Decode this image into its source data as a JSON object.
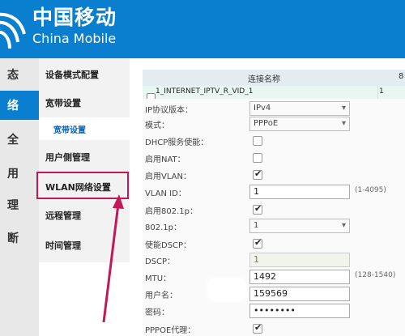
{
  "header": {
    "brand_cn": "中国移动",
    "brand_en": "China Mobile",
    "bg_color": "#0a7fd0"
  },
  "left_nav": [
    {
      "label": "态",
      "active": false
    },
    {
      "label": "络",
      "active": true
    },
    {
      "label": "全",
      "active": false
    },
    {
      "label": "用",
      "active": false
    },
    {
      "label": "理",
      "active": false
    },
    {
      "label": "断",
      "active": false
    }
  ],
  "submenu": {
    "device_mode": "设备模式配置",
    "broadband": "宽带设置",
    "broadband_child": "宽带设置",
    "user_side": "用户侧管理",
    "wlan": "WLAN网络设置",
    "remote": "远程管理",
    "time": "时间管理"
  },
  "grid": {
    "col_name": "连接名称",
    "col_2": "8",
    "row_name": "1_INTERNET_IPTV_R_VID_1",
    "row_val": "1"
  },
  "form": {
    "ip_version_label": "IP协议版本：",
    "ip_version_value": "IPv4",
    "mode_label": "模式：",
    "mode_value": "PPPoE",
    "dhcp_label": "DHCP服务使能：",
    "nat_label": "启用NAT：",
    "vlan_label": "启用VLAN：",
    "vlan_id_label": "VLAN ID：",
    "vlan_id_value": "1",
    "vlan_id_hint": "(1-4095)",
    "p8021_enable_label": "启用802.1p：",
    "p8021_label": "802.1p：",
    "p8021_value": "1",
    "dscp_enable_label": "使能DSCP：",
    "dscp_label": "DSCP：",
    "dscp_value": "1",
    "mtu_label": "MTU：",
    "mtu_value": "1492",
    "mtu_hint": "(128-1540)",
    "user_label": "用户名：",
    "user_value": "159569",
    "pwd_label": "密码：",
    "pwd_value": "••••••••",
    "pppoe_proxy_label": "PPPOE代理："
  },
  "annotation_color": "#c2185b"
}
